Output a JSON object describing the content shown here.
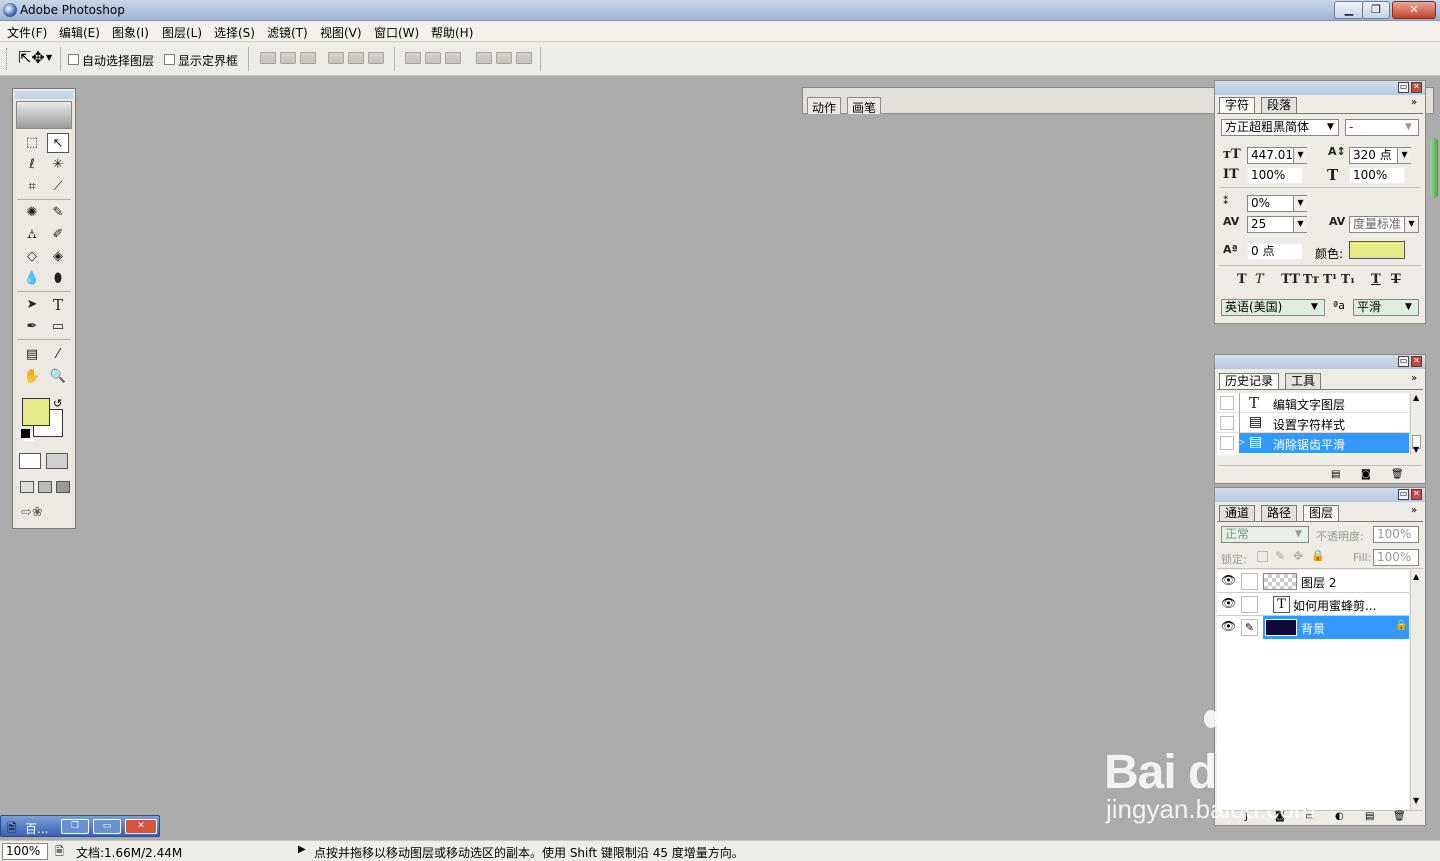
{
  "window": {
    "title": "Adobe Photoshop"
  },
  "menu": [
    "文件(F)",
    "编辑(E)",
    "图象(I)",
    "图层(L)",
    "选择(S)",
    "滤镜(T)",
    "视图(V)",
    "窗口(W)",
    "帮助(H)"
  ],
  "options": {
    "auto_select": "自动选择图层",
    "show_bounds": "显示定界框",
    "well_tabs": [
      "动作",
      "画笔"
    ]
  },
  "colors": {
    "foreground": "#e6eb8a",
    "background": "#ffffff",
    "canvas": "#ababab",
    "selection": "#3399ff"
  },
  "character_panel": {
    "tabs": [
      "字符",
      "段落"
    ],
    "font_family": "方正超粗黑简体",
    "font_style": "-",
    "font_size": "447.01 点",
    "leading": "320 点",
    "vertical_scale": "100%",
    "horizontal_scale": "100%",
    "tsume": "0%",
    "tracking": "25",
    "kerning": "度量标准",
    "baseline_shift": "0 点",
    "color_label": "颜色:",
    "color": "#e6eb8a",
    "language": "英语(美国)",
    "aa_label": "a",
    "antialias": "平滑"
  },
  "history_panel": {
    "tabs": [
      "历史记录",
      "工具"
    ],
    "items": [
      {
        "label": "编辑文字图层",
        "icon": "T"
      },
      {
        "label": "设置字符样式",
        "icon": "▤"
      },
      {
        "label": "消除锯齿平滑",
        "icon": "▤"
      }
    ]
  },
  "layers_panel": {
    "tabs": [
      "通道",
      "路径",
      "图层"
    ],
    "blend_mode": "正常",
    "opacity_label": "不透明度:",
    "opacity": "100%",
    "lock_label": "锁定:",
    "fill_label": "Fill:",
    "fill": "100%",
    "layers": [
      {
        "name": "图层 2",
        "kind": "transparent"
      },
      {
        "name": "如何用蜜蜂剪...",
        "kind": "text"
      },
      {
        "name": "背景",
        "kind": "background"
      }
    ]
  },
  "taskbar": {
    "label": "百..."
  },
  "status": {
    "zoom": "100%",
    "doc": "文档:1.66M/2.44M",
    "hint": "点按并拖移以移动图层或移动选区的副本。使用 Shift 键限制沿 45 度增量方向。"
  },
  "watermark": {
    "brand": "Bai du 经验",
    "url": "jingyan.baidu.com"
  }
}
